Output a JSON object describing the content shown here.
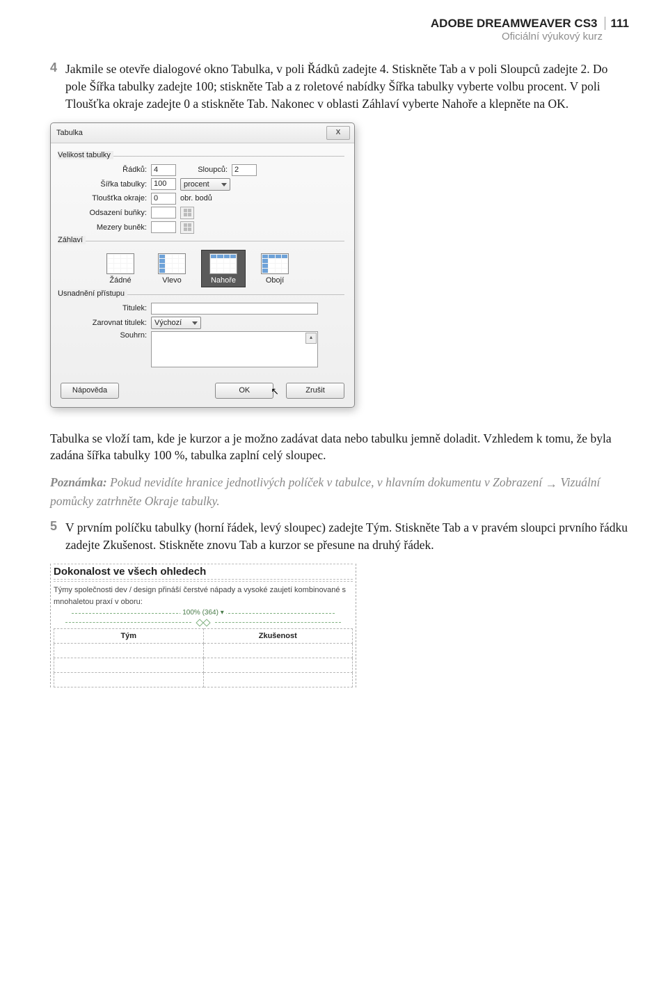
{
  "header": {
    "title": "ADOBE DREAMWEAVER CS3",
    "pagenum": "111",
    "subtitle": "Oficiální výukový kurz"
  },
  "step4": {
    "num": "4",
    "text": "Jakmile se otevře dialogové okno Tabulka, v poli Řádků zadejte 4. Stiskněte Tab a v poli Sloupců zadejte 2. Do pole Šířka tabulky zadejte 100; stiskněte Tab a z roletové nabídky Šířka tabulky vyberte volbu procent. V poli Tloušťka okraje zadejte 0 a stiskněte Tab. Nakonec v oblasti Záhlaví vyberte Nahoře a klepněte na OK."
  },
  "dialog": {
    "title": "Tabulka",
    "close": "X",
    "fs_size": "Velikost tabulky",
    "rows_label": "Řádků:",
    "rows_value": "4",
    "cols_label": "Sloupců:",
    "cols_value": "2",
    "width_label": "Šířka tabulky:",
    "width_value": "100",
    "width_unit": "procent",
    "border_label": "Tloušťka okraje:",
    "border_value": "0",
    "border_unit": "obr. bodů",
    "cellpad_label": "Odsazení buňky:",
    "cellspace_label": "Mezery buněk:",
    "fs_header": "Záhlaví",
    "hopt_none": "Žádné",
    "hopt_left": "Vlevo",
    "hopt_top": "Nahoře",
    "hopt_both": "Obojí",
    "fs_access": "Usnadnění přístupu",
    "caption_label": "Titulek:",
    "align_label": "Zarovnat titulek:",
    "align_value": "Výchozí",
    "summary_label": "Souhrn:",
    "btn_help": "Nápověda",
    "btn_ok": "OK",
    "btn_cancel": "Zrušit"
  },
  "para_after": "Tabulka se vloží tam, kde je kurzor a je možno zadávat data nebo tabulku jemně doladit. Vzhledem k tomu, že byla zadána šířka tabulky 100 %, tabulka zaplní celý sloupec.",
  "note": {
    "label": "Poznámka:",
    "text_a": "Pokud nevidíte hranice jednotlivých políček v tabulce, v hlavním dokumentu v Zobrazení ",
    "text_b": " Vizuální pomůcky zatrhněte Okraje tabulky."
  },
  "step5": {
    "num": "5",
    "text": "V prvním políčku tabulky (horní řádek, levý sloupec) zadejte Tým. Stiskněte Tab a v pravém sloupci prvního řádku zadejte Zkušenost. Stiskněte znovu Tab a kurzor se přesune na druhý řádek."
  },
  "preview": {
    "heading": "Dokonalost ve všech ohledech",
    "para": "Týmy společnosti dev / design přináší čerstvé nápady a vysoké zaujetí kombinované s mnohaletou praxí v oboru:",
    "ruler": "100% (364) ▾",
    "th1": "Tým",
    "th2": "Zkušenost"
  }
}
